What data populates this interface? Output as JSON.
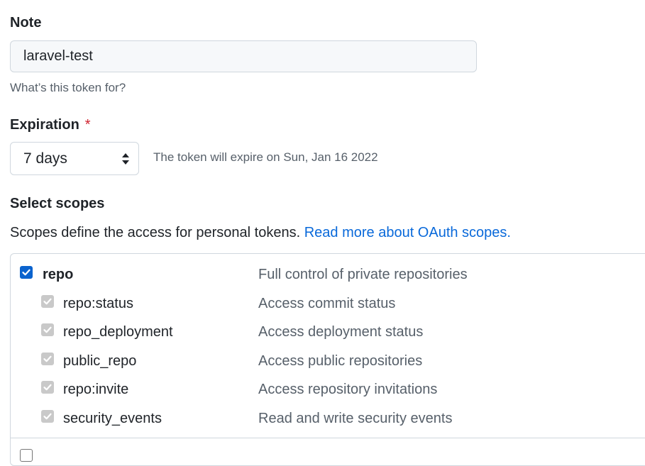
{
  "note": {
    "label": "Note",
    "value": "laravel-test",
    "hint": "What’s this token for?"
  },
  "expiration": {
    "label": "Expiration",
    "required_mark": "*",
    "selected": "7 days",
    "note": "The token will expire on Sun, Jan 16 2022"
  },
  "scopes": {
    "heading": "Select scopes",
    "description": "Scopes define the access for personal tokens.",
    "link_text": "Read more about OAuth scopes.",
    "parent": {
      "name": "repo",
      "description": "Full control of private repositories",
      "checked": true
    },
    "children": [
      {
        "name": "repo:status",
        "description": "Access commit status"
      },
      {
        "name": "repo_deployment",
        "description": "Access deployment status"
      },
      {
        "name": "public_repo",
        "description": "Access public repositories"
      },
      {
        "name": "repo:invite",
        "description": "Access repository invitations"
      },
      {
        "name": "security_events",
        "description": "Read and write security events"
      }
    ]
  },
  "colors": {
    "checkbox_checked": "#0b63ce",
    "checkbox_disabled": "#c9c9c9",
    "link": "#0969da",
    "required": "#cf222e"
  }
}
